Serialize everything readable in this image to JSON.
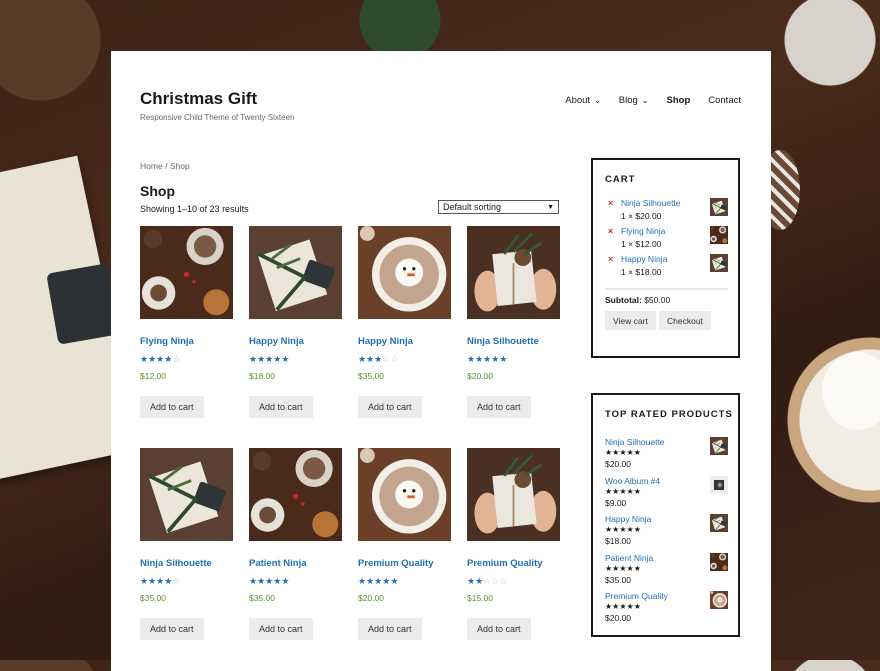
{
  "site": {
    "title": "Christmas Gift",
    "description": "Responsive Child Theme of Twenty Sixteen"
  },
  "nav": [
    {
      "label": "About",
      "has_dropdown": true
    },
    {
      "label": "Blog",
      "has_dropdown": true
    },
    {
      "label": "Shop",
      "current": true
    },
    {
      "label": "Contact"
    }
  ],
  "breadcrumb": {
    "home": "Home",
    "separator": "/",
    "current": "Shop"
  },
  "shop": {
    "title": "Shop",
    "result_count": "Showing 1–10 of 23 results",
    "sorting": "Default sorting"
  },
  "products": [
    {
      "name": "Flying Ninja",
      "rating": 4,
      "price": "$12.00",
      "button": "Add to cart",
      "image": "pinecones"
    },
    {
      "name": "Happy Ninja",
      "rating": 5,
      "price": "$18.00",
      "button": "Add to cart",
      "image": "gift-box"
    },
    {
      "name": "Happy Ninja",
      "rating": 3,
      "price": "$35.00",
      "button": "Add to cart",
      "image": "cocoa-mug"
    },
    {
      "name": "Ninja Silhouette",
      "rating": 5,
      "price": "$20.00",
      "button": "Add to cart",
      "image": "hands-gift"
    },
    {
      "name": "Ninja Silhouette",
      "rating": 4,
      "price": "$35.00",
      "button": "Add to cart",
      "image": "gift-box"
    },
    {
      "name": "Patient Ninja",
      "rating": 4.5,
      "price": "$35.00",
      "button": "Add to cart",
      "image": "pinecones"
    },
    {
      "name": "Premium Quality",
      "rating": 4.5,
      "price": "$20.00",
      "button": "Add to cart",
      "image": "cocoa-mug"
    },
    {
      "name": "Premium Quality",
      "rating": 2,
      "price": "$15.00",
      "button": "Add to cart",
      "image": "hands-gift"
    }
  ],
  "cart": {
    "title": "CART",
    "remove_glyph": "×",
    "items": [
      {
        "name": "Ninja Silhouette",
        "qty": "1 × $20.00",
        "image": "gift-box"
      },
      {
        "name": "Flying Ninja",
        "qty": "1 × $12.00",
        "image": "pinecones"
      },
      {
        "name": "Happy Ninja",
        "qty": "1 × $18.00",
        "image": "gift-box"
      }
    ],
    "subtotal_label": "Subtotal:",
    "subtotal_value": "$50.00",
    "view_cart": "View cart",
    "checkout": "Checkout"
  },
  "top_rated": {
    "title": "TOP RATED PRODUCTS",
    "items": [
      {
        "name": "Ninja Silhouette",
        "rating": 5,
        "price": "$20.00",
        "image": "gift-box"
      },
      {
        "name": "Woo Album #4",
        "rating": 5,
        "price": "$9.00",
        "image": "album"
      },
      {
        "name": "Happy Ninja",
        "rating": 5,
        "price": "$18.00",
        "image": "gift-box"
      },
      {
        "name": "Patient Ninja",
        "rating": 5,
        "price": "$35.00",
        "image": "pinecones"
      },
      {
        "name": "Premium Quality",
        "rating": 4.5,
        "price": "$20.00",
        "image": "cocoa-mug"
      }
    ]
  },
  "colors": {
    "link": "#1f6fb5",
    "price": "#5b8f2d",
    "remove": "#d02b2b",
    "button_bg": "#ebebeb"
  }
}
